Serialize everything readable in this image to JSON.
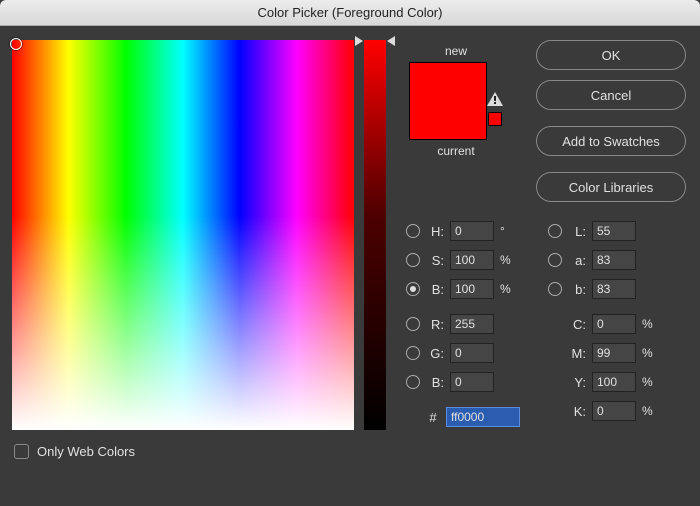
{
  "window": {
    "title": "Color Picker (Foreground Color)"
  },
  "swatch": {
    "new_label": "new",
    "current_label": "current",
    "color": "#ff0000"
  },
  "buttons": {
    "ok": "OK",
    "cancel": "Cancel",
    "add_swatches": "Add to Swatches",
    "color_libraries": "Color Libraries"
  },
  "only_web": {
    "label": "Only Web Colors",
    "checked": false
  },
  "hsb": {
    "h_label": "H:",
    "h": "0",
    "h_unit": "°",
    "s_label": "S:",
    "s": "100",
    "s_unit": "%",
    "b_label": "B:",
    "b": "100",
    "b_unit": "%",
    "selected": "B"
  },
  "rgb": {
    "r_label": "R:",
    "r": "255",
    "g_label": "G:",
    "g": "0",
    "b_label": "B:",
    "b": "0"
  },
  "lab": {
    "l_label": "L:",
    "l": "55",
    "a_label": "a:",
    "a": "83",
    "b_label": "b:",
    "b": "83"
  },
  "cmyk": {
    "c_label": "C:",
    "c": "0",
    "m_label": "M:",
    "m": "99",
    "y_label": "Y:",
    "y": "100",
    "k_label": "K:",
    "k": "0",
    "unit": "%"
  },
  "hex": {
    "prefix": "#",
    "value": "ff0000"
  }
}
